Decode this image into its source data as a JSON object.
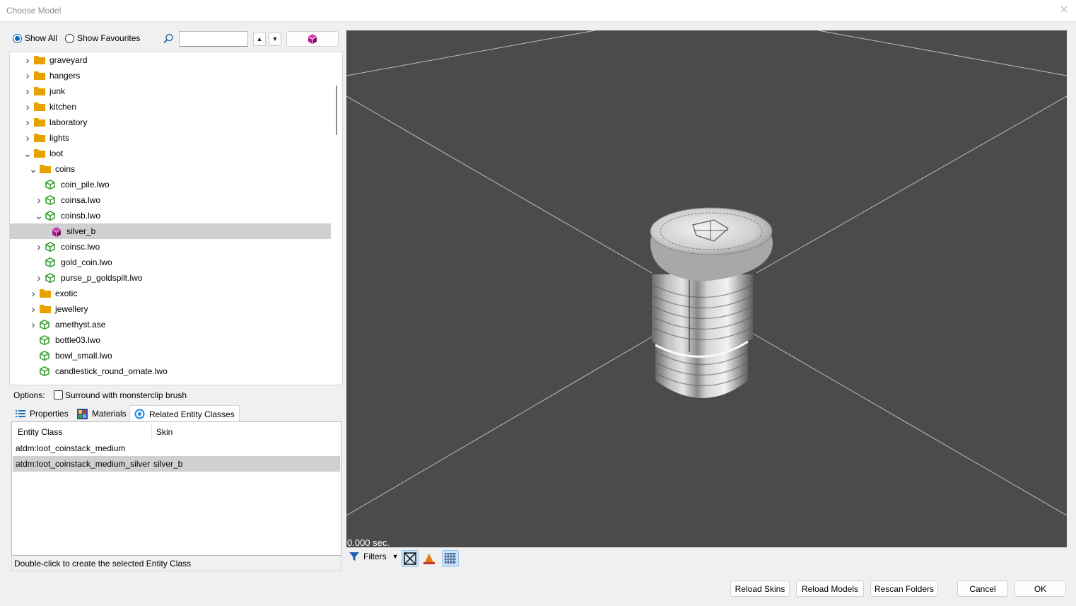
{
  "window": {
    "title": "Choose Model"
  },
  "toolbar": {
    "show_all": "Show All",
    "show_favourites": "Show Favourites",
    "search_value": ""
  },
  "tree": {
    "items": [
      {
        "label": "graveyard",
        "type": "folder",
        "expanded": false
      },
      {
        "label": "hangers",
        "type": "folder",
        "expanded": false
      },
      {
        "label": "junk",
        "type": "folder",
        "expanded": false
      },
      {
        "label": "kitchen",
        "type": "folder",
        "expanded": false
      },
      {
        "label": "laboratory",
        "type": "folder",
        "expanded": false
      },
      {
        "label": "lights",
        "type": "folder",
        "expanded": false
      },
      {
        "label": "loot",
        "type": "folder",
        "expanded": true
      },
      {
        "label": "coins",
        "type": "folder",
        "expanded": true
      },
      {
        "label": "coin_pile.lwo",
        "type": "model"
      },
      {
        "label": "coinsa.lwo",
        "type": "model",
        "expanded": false
      },
      {
        "label": "coinsb.lwo",
        "type": "model",
        "expanded": true
      },
      {
        "label": "silver_b",
        "type": "skin",
        "selected": true
      },
      {
        "label": "coinsc.lwo",
        "type": "model",
        "expanded": false
      },
      {
        "label": "gold_coin.lwo",
        "type": "model"
      },
      {
        "label": "purse_p_goldspilt.lwo",
        "type": "model",
        "expanded": false
      },
      {
        "label": "exotic",
        "type": "folder",
        "expanded": false
      },
      {
        "label": "jewellery",
        "type": "folder",
        "expanded": false
      },
      {
        "label": "amethyst.ase",
        "type": "model",
        "expanded": false
      },
      {
        "label": "bottle03.lwo",
        "type": "model"
      },
      {
        "label": "bowl_small.lwo",
        "type": "model"
      },
      {
        "label": "candlestick_round_ornate.lwo",
        "type": "model"
      }
    ]
  },
  "options": {
    "label": "Options:",
    "monsterclip": "Surround with monsterclip brush"
  },
  "tabs": [
    {
      "label": "Properties"
    },
    {
      "label": "Materials"
    },
    {
      "label": "Related Entity Classes"
    }
  ],
  "entity_table": {
    "headers": [
      "Entity Class",
      "Skin"
    ],
    "rows": [
      {
        "entity_class": "atdm:loot_coinstack_medium",
        "skin": ""
      },
      {
        "entity_class": "atdm:loot_coinstack_medium_silver",
        "skin": "silver_b"
      }
    ]
  },
  "status": "Double-click to create the selected Entity Class",
  "viewport": {
    "time": "0.000 sec."
  },
  "filters_label": "Filters",
  "buttons": {
    "reload_skins": "Reload Skins",
    "reload_models": "Reload Models",
    "rescan_folders": "Rescan Folders",
    "cancel": "Cancel",
    "ok": "OK"
  },
  "colors": {
    "folder": "#e8a200",
    "model": "#3aa335",
    "skin": "#b0138f",
    "viewport_bg": "#4b4b4b",
    "accent": "#0067c0"
  }
}
